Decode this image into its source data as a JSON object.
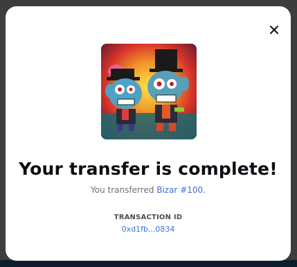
{
  "modal": {
    "title": "Your transfer is complete!",
    "subtitle_prefix": "You transferred ",
    "item_name": "Bizar #100",
    "subtitle_suffix": ".",
    "transaction_label": "TRANSACTION ID",
    "transaction_id": "0xd1fb...0834",
    "close_icon": "close-icon",
    "image_alt": "Bizar #100"
  },
  "colors": {
    "link": "#3b6fd4",
    "title": "#0b0d12",
    "backdrop": "#3d3d3d"
  }
}
